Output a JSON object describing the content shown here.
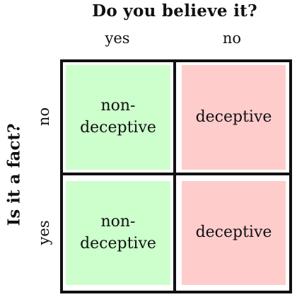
{
  "columns": {
    "title": "Do you believe it?",
    "yes_label": "yes",
    "no_label": "no"
  },
  "rows": {
    "title": "Is it a fact?",
    "no_label": "no",
    "yes_label": "yes"
  },
  "cells": {
    "not_fact_believed": "non-\ndeceptive",
    "not_fact_not_believed": "deceptive",
    "fact_believed": "non-\ndeceptive",
    "fact_not_believed": "deceptive"
  },
  "colors": {
    "non_deceptive": "#ccffcc",
    "deceptive": "#ffcccc",
    "border": "#111111"
  }
}
